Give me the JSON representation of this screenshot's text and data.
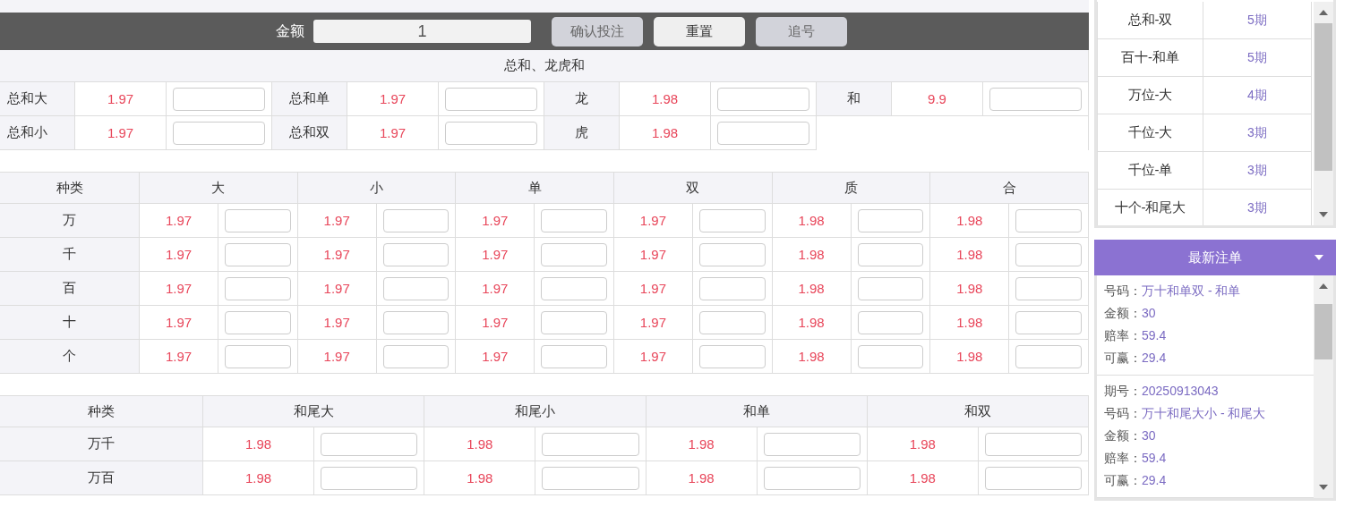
{
  "amount_bar": {
    "label": "金额",
    "value": "1",
    "buttons": [
      {
        "label": "确认投注",
        "disabled": true
      },
      {
        "label": "重置",
        "disabled": false
      },
      {
        "label": "追号",
        "disabled": true
      }
    ]
  },
  "sum_section": {
    "title": "总和、龙虎和",
    "rows": [
      [
        {
          "label": "总和大",
          "odds": "1.97"
        },
        {
          "label": "总和单",
          "odds": "1.97"
        },
        {
          "label": "龙",
          "odds": "1.98"
        },
        {
          "label": "和",
          "odds": "9.9"
        }
      ],
      [
        {
          "label": "总和小",
          "odds": "1.97"
        },
        {
          "label": "总和双",
          "odds": "1.97"
        },
        {
          "label": "虎",
          "odds": "1.98"
        }
      ]
    ]
  },
  "position_table": {
    "columns": [
      "种类",
      "大",
      "小",
      "单",
      "双",
      "质",
      "合"
    ],
    "rows": [
      {
        "label": "万",
        "odds": [
          "1.97",
          "1.97",
          "1.97",
          "1.97",
          "1.98",
          "1.98"
        ]
      },
      {
        "label": "千",
        "odds": [
          "1.97",
          "1.97",
          "1.97",
          "1.97",
          "1.98",
          "1.98"
        ]
      },
      {
        "label": "百",
        "odds": [
          "1.97",
          "1.97",
          "1.97",
          "1.97",
          "1.98",
          "1.98"
        ]
      },
      {
        "label": "十",
        "odds": [
          "1.97",
          "1.97",
          "1.97",
          "1.97",
          "1.98",
          "1.98"
        ]
      },
      {
        "label": "个",
        "odds": [
          "1.97",
          "1.97",
          "1.97",
          "1.97",
          "1.98",
          "1.98"
        ]
      }
    ]
  },
  "pair_table": {
    "columns": [
      "种类",
      "和尾大",
      "和尾小",
      "和单",
      "和双"
    ],
    "rows": [
      {
        "label": "万千",
        "odds": [
          "1.98",
          "1.98",
          "1.98",
          "1.98"
        ]
      },
      {
        "label": "万百",
        "odds": [
          "1.98",
          "1.98",
          "1.98",
          "1.98"
        ]
      }
    ]
  },
  "trend_list": {
    "rows": [
      {
        "name": "总和-双",
        "count": "5期"
      },
      {
        "name": "百十-和单",
        "count": "5期"
      },
      {
        "name": "万位-大",
        "count": "4期"
      },
      {
        "name": "千位-大",
        "count": "3期"
      },
      {
        "name": "千位-单",
        "count": "3期"
      },
      {
        "name": "十个-和尾大",
        "count": "3期"
      }
    ]
  },
  "latest_bets": {
    "title": "最新注单",
    "entries": [
      {
        "fields": [
          {
            "label": "号码：",
            "value": "万十和单双 - 和单"
          },
          {
            "label": "金额：",
            "value": "30"
          },
          {
            "label": "赔率：",
            "value": "59.4"
          },
          {
            "label": "可赢：",
            "value": "29.4"
          }
        ]
      },
      {
        "fields": [
          {
            "label": "期号：",
            "value": "20250913043"
          },
          {
            "label": "号码：",
            "value": "万十和尾大小 - 和尾大"
          },
          {
            "label": "金额：",
            "value": "30"
          },
          {
            "label": "赔率：",
            "value": "59.4"
          },
          {
            "label": "可赢：",
            "value": "29.4"
          }
        ]
      }
    ]
  }
}
